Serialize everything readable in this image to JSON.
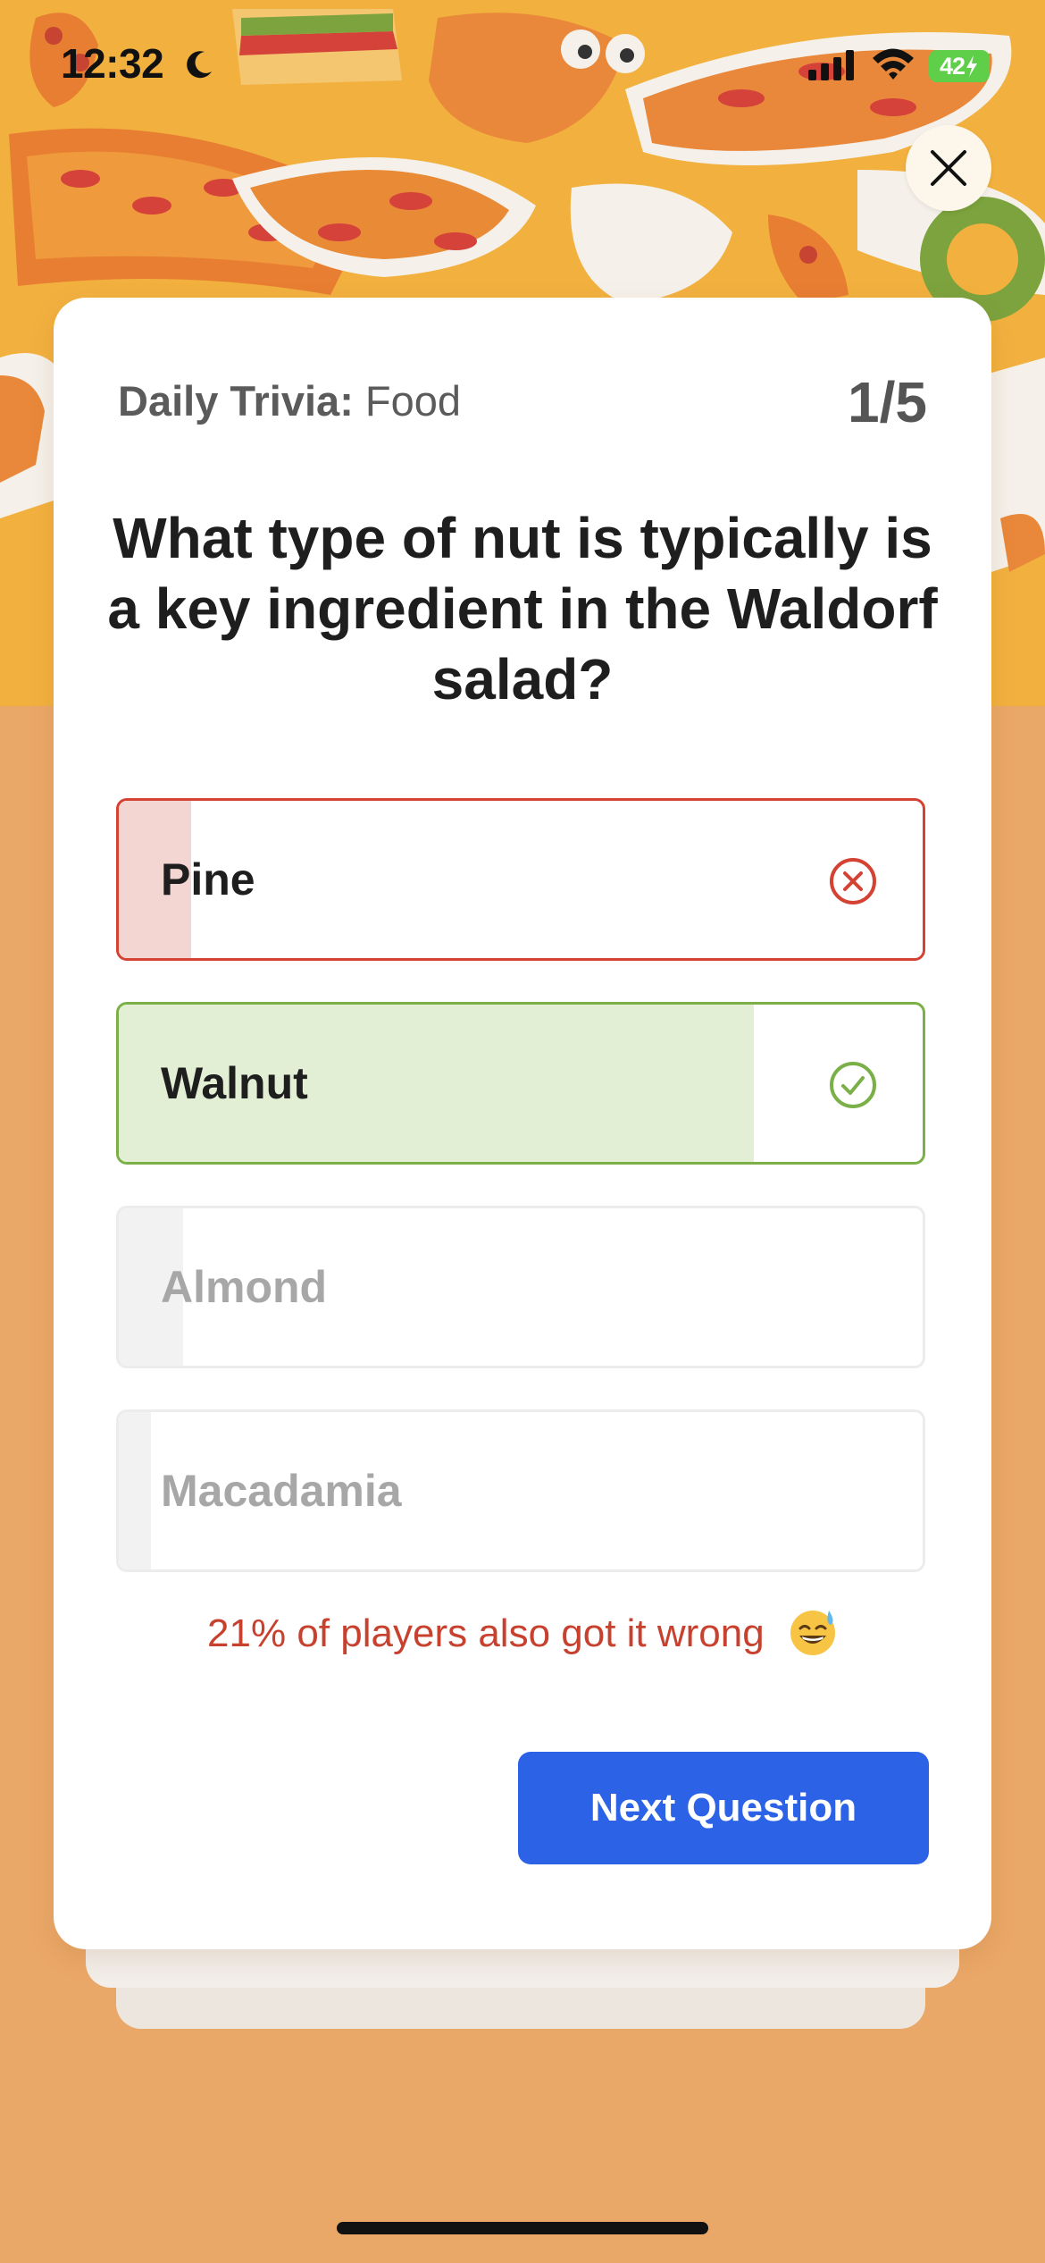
{
  "status_bar": {
    "time": "12:32",
    "battery": "42"
  },
  "header": {
    "title_bold": "Daily Trivia:",
    "title_category": "Food",
    "progress": "1/5"
  },
  "question": "What type of nut is typically is a key ingredient in the Waldorf salad?",
  "answers": [
    {
      "label": "Pine",
      "state": "wrong-selected",
      "fraction": 0.09
    },
    {
      "label": "Walnut",
      "state": "correct",
      "fraction": 0.79
    },
    {
      "label": "Almond",
      "state": "neutral",
      "fraction": 0.08
    },
    {
      "label": "Macadamia",
      "state": "neutral",
      "fraction": 0.04
    }
  ],
  "result_message": "21% of players also got it wrong",
  "next_button_label": "Next Question",
  "colors": {
    "wrong": "#d44233",
    "correct": "#7bb048",
    "primary": "#2c63e6",
    "background": "#eaa868"
  }
}
